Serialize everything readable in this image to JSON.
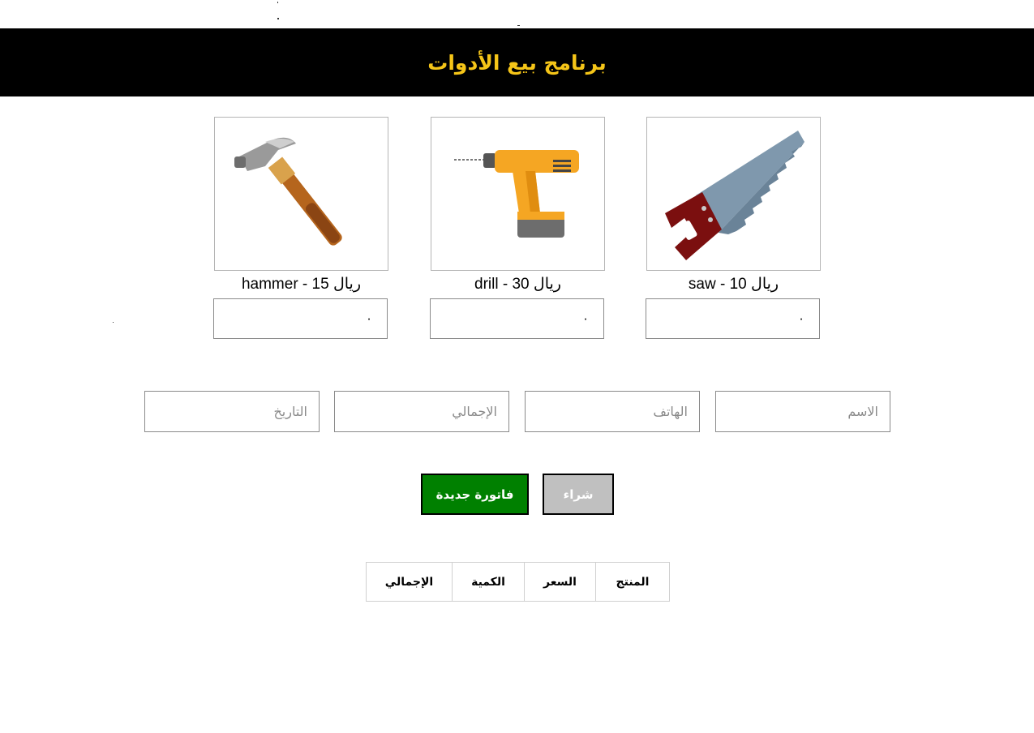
{
  "header": {
    "title": "برنامج بيع الأدوات"
  },
  "tools": [
    {
      "name": "saw",
      "price": "10",
      "currency": "ريال",
      "caption": "saw - 10 ريال",
      "icon": "saw-icon",
      "qty": "٠"
    },
    {
      "name": "drill",
      "price": "30",
      "currency": "ريال",
      "caption": "drill - 30 ريال",
      "icon": "drill-icon",
      "qty": "٠"
    },
    {
      "name": "hammer",
      "price": "15",
      "currency": "ريال",
      "caption": "hammer - 15 ريال",
      "icon": "hammer-icon",
      "qty": "٠"
    }
  ],
  "form": {
    "name_placeholder": "الاسم",
    "phone_placeholder": "الهاتف",
    "total_placeholder": "الإجمالي",
    "date_placeholder": "التاريخ"
  },
  "buttons": {
    "buy_label": "شراء",
    "new_invoice_label": "فاتورة جديدة"
  },
  "invoice_table": {
    "headers": [
      "المنتج",
      "السعر",
      "الكمية",
      "الإجمالي"
    ]
  },
  "colors": {
    "header_bg": "#000000",
    "title": "#f5c518",
    "new_invoice_bg": "#008000",
    "buy_bg": "#c0c0c0"
  }
}
